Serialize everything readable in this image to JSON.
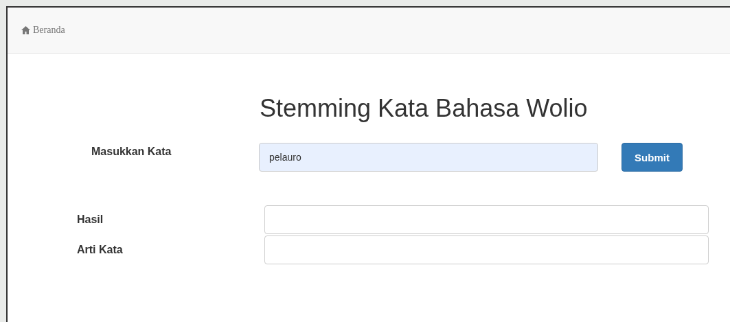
{
  "navbar": {
    "link": "Beranda"
  },
  "title": "Stemming Kata Bahasa Wolio",
  "input_form": {
    "label": "Masukkan Kata",
    "value": "pelauro",
    "button": "Submit"
  },
  "results": [
    {
      "label": "Hasil"
    },
    {
      "label": "Arti Kata"
    }
  ]
}
